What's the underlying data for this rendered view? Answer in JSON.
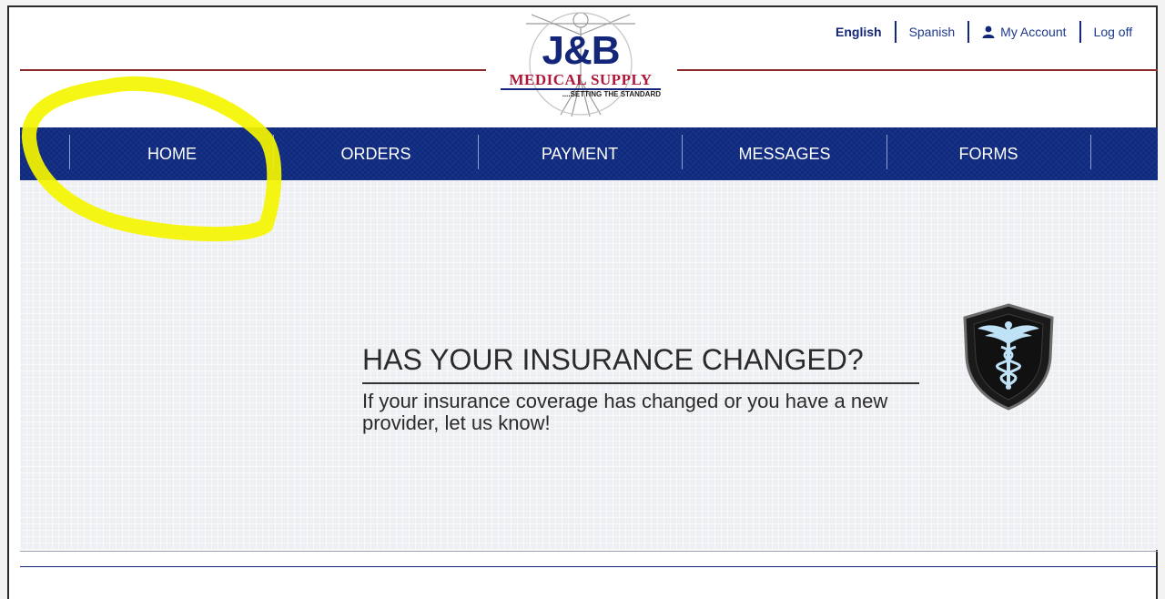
{
  "logo": {
    "brand": "J&B",
    "name": "MEDICAL SUPPLY",
    "tagline": "....SETTING THE STANDARD"
  },
  "toplinks": {
    "english": "English",
    "spanish": "Spanish",
    "my_account": "My Account",
    "log_off": "Log off",
    "account_icon": "user-icon"
  },
  "nav": {
    "home": "HOME",
    "orders": "ORDERS",
    "payment": "PAYMENT",
    "messages": "MESSAGES",
    "forms": "FORMS"
  },
  "promo": {
    "title": "HAS YOUR INSURANCE CHANGED?",
    "body": "If your insurance coverage has changed or you have a new provider, let us know!",
    "icon": "caduceus-shield-icon"
  },
  "colors": {
    "navbar": "#0f2a7e",
    "brand_blue": "#13267a",
    "brand_red": "#b0183a",
    "highlight": "#f5f500"
  }
}
